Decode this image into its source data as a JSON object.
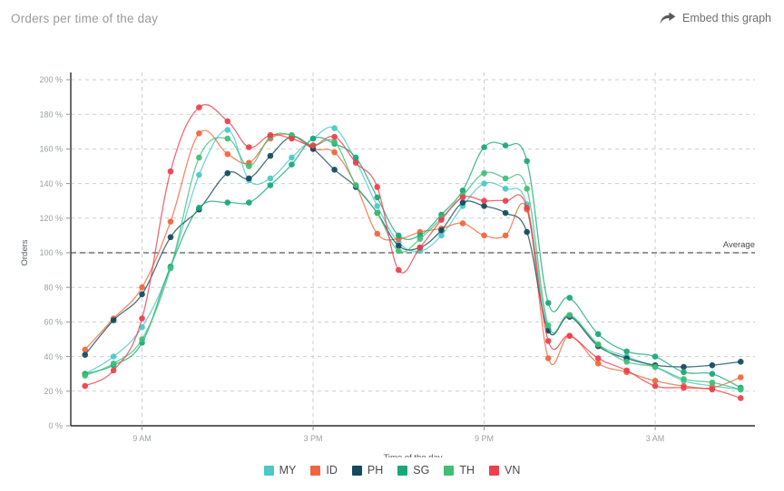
{
  "header": {
    "title": "Orders per time of the day",
    "embed_label": "Embed this graph",
    "embed_icon": "share-arrow-icon"
  },
  "chart_data": {
    "type": "line",
    "title": "Orders per time of the day",
    "xlabel": "Time of the day",
    "ylabel": "Orders",
    "ylim": [
      0,
      200
    ],
    "y_tick_labels": [
      "0 %",
      "20 %",
      "40 %",
      "60 %",
      "80 %",
      "100 %",
      "120 %",
      "140 %",
      "160 %",
      "180 %",
      "200 %"
    ],
    "y_ticks": [
      0,
      20,
      40,
      60,
      80,
      100,
      120,
      140,
      160,
      180,
      200
    ],
    "y_unit": "%",
    "grid": true,
    "legend_position": "bottom",
    "annotation": {
      "label": "Average",
      "value": 100,
      "style": "dashed"
    },
    "x_tick_labels": [
      "9 AM",
      "3 PM",
      "9 PM",
      "3 AM"
    ],
    "x_tick_values": [
      9,
      15,
      21,
      27
    ],
    "x_start": 6.5,
    "x_end": 30.5,
    "x": [
      7,
      8,
      9,
      10,
      11,
      12,
      12.75,
      13.5,
      14.25,
      15,
      15.75,
      16.5,
      17.25,
      18,
      18.75,
      19.5,
      20.25,
      21,
      21.75,
      22.5,
      23.25,
      24,
      25,
      26,
      27,
      28,
      29,
      30
    ],
    "series": [
      {
        "name": "MY",
        "color": "#4bc8c8",
        "values": [
          30,
          40,
          57,
          92,
          145,
          171,
          142,
          143,
          155,
          166,
          172,
          153,
          127,
          106,
          101,
          110,
          127,
          140,
          137,
          128,
          56,
          64,
          47,
          40,
          34,
          26,
          23,
          21
        ]
      },
      {
        "name": "ID",
        "color": "#f2663c",
        "values": [
          44,
          62,
          80,
          118,
          169,
          157,
          152,
          166,
          168,
          160,
          158,
          139,
          111,
          108,
          112,
          114,
          117,
          110,
          110,
          125,
          39,
          52,
          36,
          31,
          26,
          23,
          22,
          28
        ]
      },
      {
        "name": "PH",
        "color": "#134a5e",
        "values": [
          41,
          61,
          76,
          109,
          125,
          146,
          143,
          156,
          167,
          160,
          148,
          138,
          123,
          104,
          103,
          113,
          129,
          127,
          123,
          112,
          55,
          63,
          46,
          39,
          35,
          34,
          35,
          37
        ]
      },
      {
        "name": "SG",
        "color": "#1aa87a",
        "values": [
          30,
          35,
          48,
          92,
          126,
          129,
          129,
          139,
          151,
          166,
          163,
          155,
          132,
          110,
          110,
          122,
          136,
          161,
          162,
          153,
          71,
          74,
          53,
          43,
          40,
          31,
          30,
          22
        ]
      },
      {
        "name": "TH",
        "color": "#3fbf75",
        "values": [
          29,
          36,
          50,
          91,
          155,
          166,
          150,
          167,
          168,
          162,
          164,
          139,
          123,
          101,
          108,
          120,
          133,
          146,
          143,
          137,
          58,
          64,
          47,
          37,
          34,
          27,
          25,
          21
        ]
      },
      {
        "name": "VN",
        "color": "#ee3f4a",
        "values": [
          23,
          32,
          62,
          147,
          184,
          176,
          161,
          168,
          166,
          162,
          167,
          152,
          138,
          90,
          103,
          119,
          132,
          130,
          130,
          126,
          49,
          52,
          39,
          32,
          23,
          22,
          21,
          16
        ]
      }
    ]
  },
  "legend": [
    {
      "label": "MY",
      "color": "#4bc8c8"
    },
    {
      "label": "ID",
      "color": "#f2663c"
    },
    {
      "label": "PH",
      "color": "#134a5e"
    },
    {
      "label": "SG",
      "color": "#1aa87a"
    },
    {
      "label": "TH",
      "color": "#3fbf75"
    },
    {
      "label": "VN",
      "color": "#ee3f4a"
    }
  ]
}
